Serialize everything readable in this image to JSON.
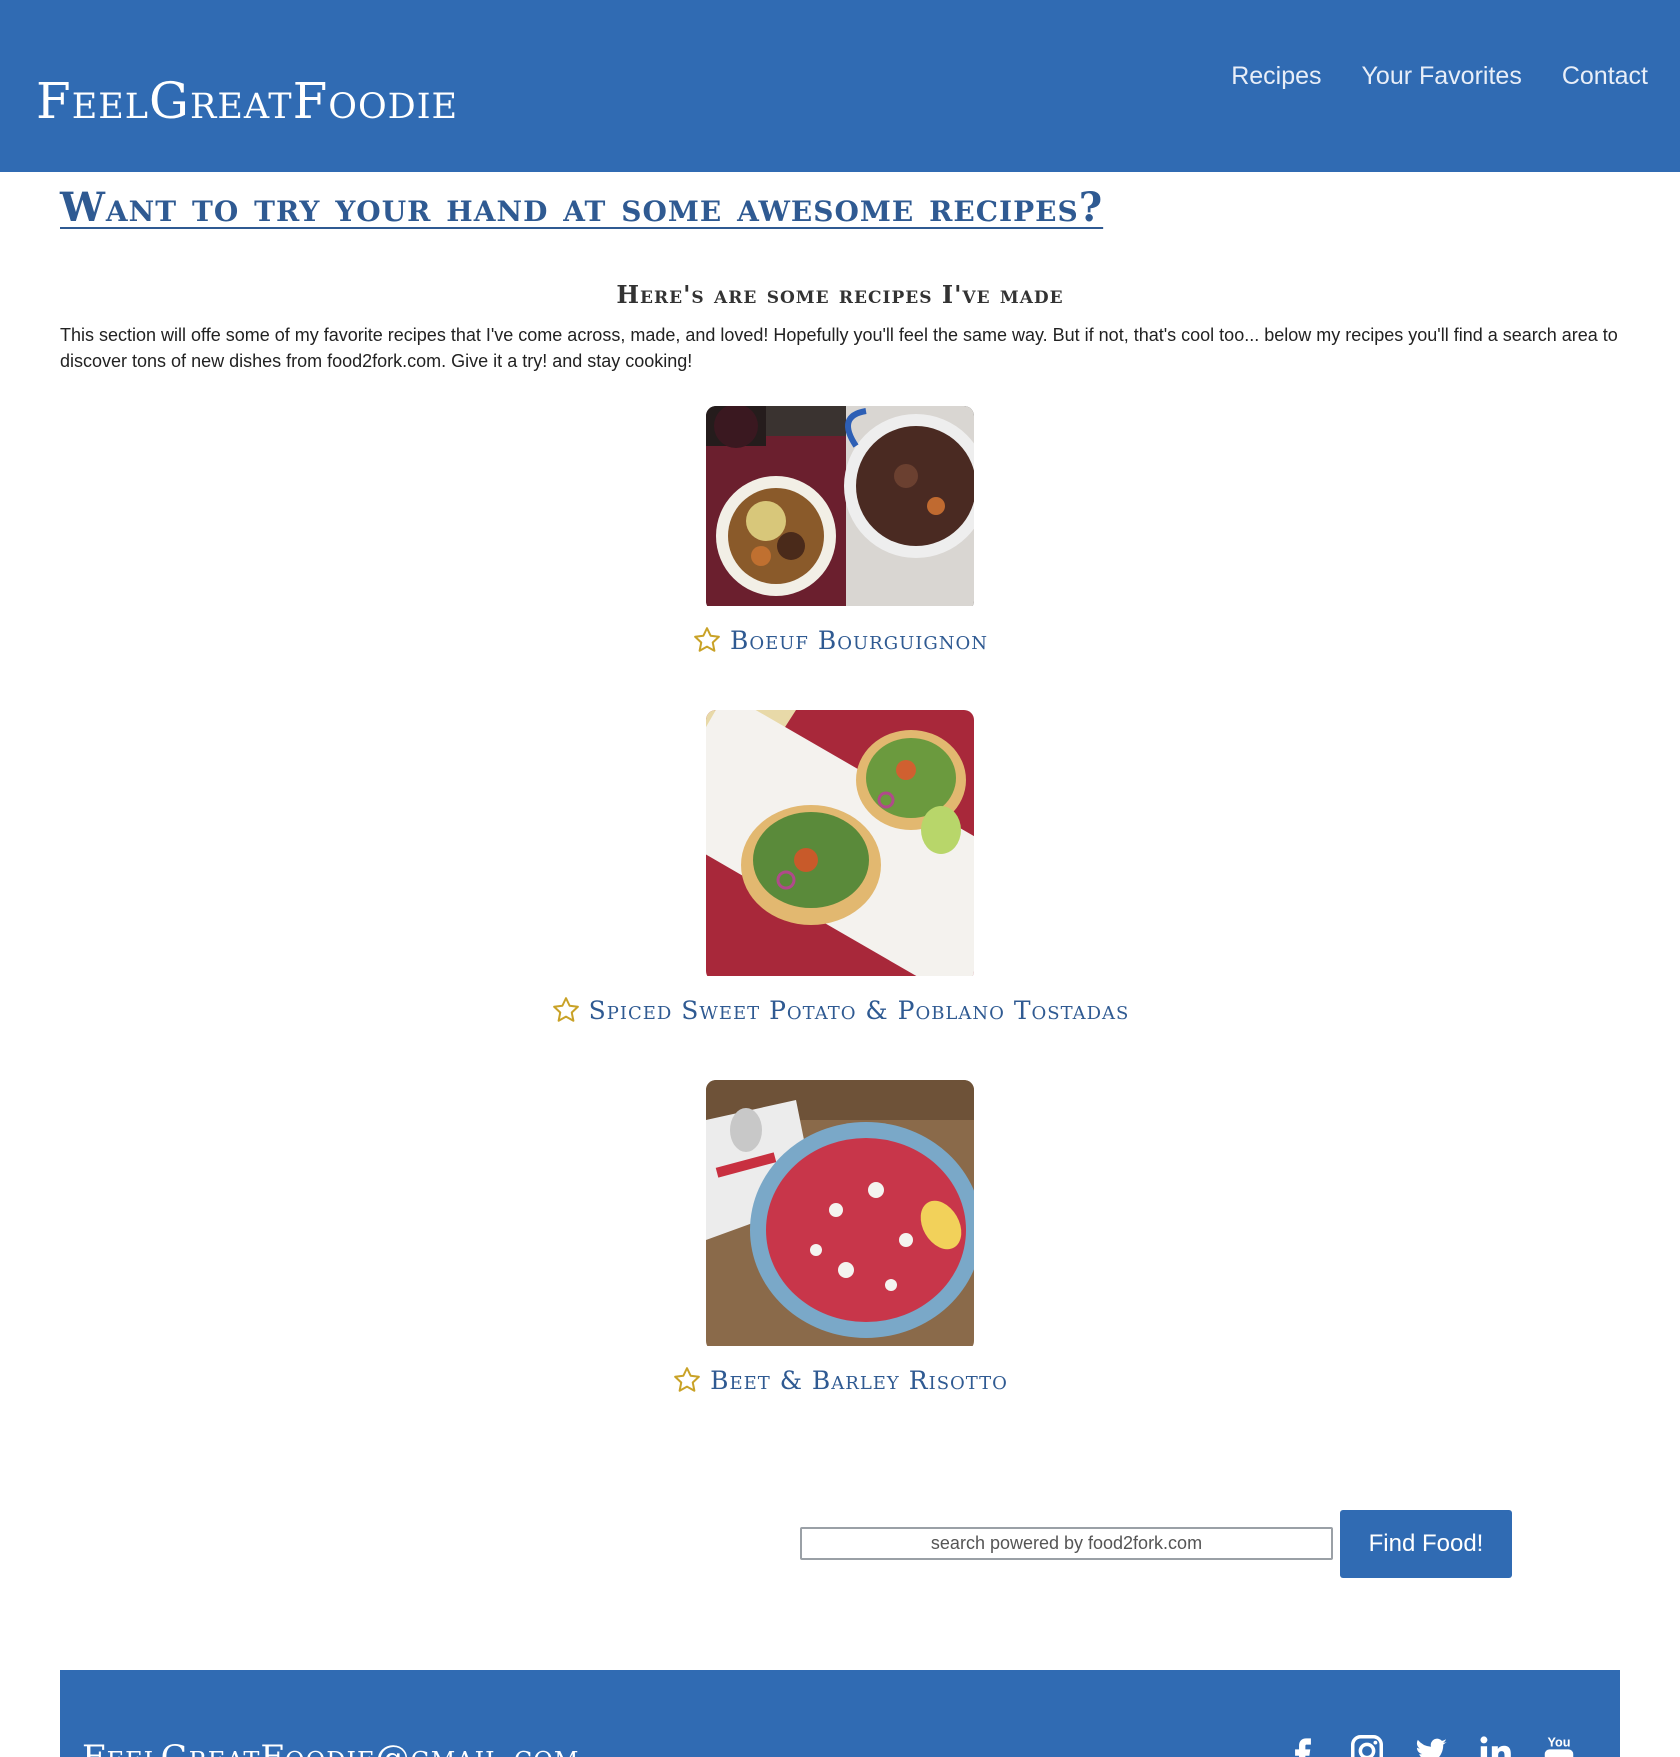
{
  "header": {
    "brand": "FeelGreatFoodie",
    "nav": [
      "Recipes",
      "Your Favorites",
      "Contact"
    ]
  },
  "hero": {
    "title": "Want to try your hand at some awesome recipes?"
  },
  "section": {
    "subheading": "Here's are some recipes I've made",
    "intro": "This section will offe some of my favorite recipes that I've come across, made, and loved! Hopefully you'll feel the same way. But if not, that's cool too... below my recipes you'll find a search area to discover tons of new dishes from food2fork.com. Give it a try! and stay cooking!"
  },
  "recipes": [
    {
      "title": "Boeuf Bourguignon"
    },
    {
      "title": "Spiced Sweet Potato & Poblano Tostadas"
    },
    {
      "title": "Beet & Barley Risotto"
    }
  ],
  "search": {
    "placeholder": "search powered by food2fork.com",
    "button": "Find Food!"
  },
  "footer": {
    "email": "FeelGreatFoodie@gmail.com",
    "social_icons": [
      "facebook-icon",
      "instagram-icon",
      "twitter-icon",
      "linkedin-icon",
      "youtube-icon"
    ]
  },
  "colors": {
    "brand": "#306bb3",
    "link": "#2f5a92",
    "star": "#c9a227"
  }
}
